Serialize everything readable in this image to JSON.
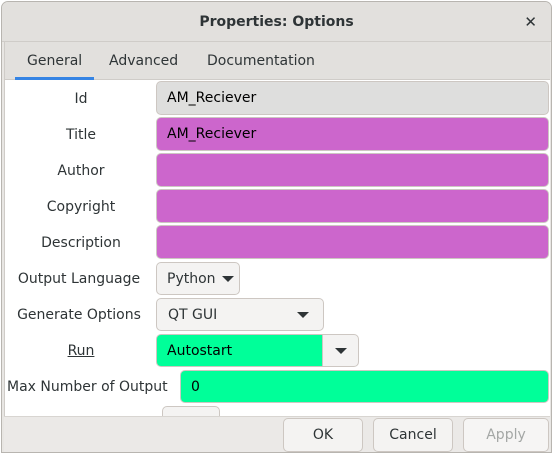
{
  "window": {
    "title": "Properties: Options",
    "close_icon": "close-icon"
  },
  "tabs": [
    {
      "label": "General",
      "active": true
    },
    {
      "label": "Advanced"
    },
    {
      "label": "Documentation"
    }
  ],
  "fields": {
    "id": {
      "label": "Id",
      "value": "AM_Reciever"
    },
    "title": {
      "label": "Title",
      "value": "AM_Reciever"
    },
    "author": {
      "label": "Author",
      "value": ""
    },
    "copyright": {
      "label": "Copyright",
      "value": ""
    },
    "description": {
      "label": "Description",
      "value": ""
    },
    "output_language": {
      "label": "Output Language",
      "value": "Python"
    },
    "generate_options": {
      "label": "Generate Options",
      "value": "QT GUI"
    },
    "run": {
      "label": "Run",
      "value": "Autostart"
    },
    "max_outputs": {
      "label": "Max Number of Output",
      "value": "0"
    }
  },
  "buttons": {
    "ok": "OK",
    "cancel": "Cancel",
    "apply": "Apply"
  },
  "colors": {
    "pink": "#cc66cc",
    "green": "#00ff99",
    "accent": "#3584e4"
  }
}
